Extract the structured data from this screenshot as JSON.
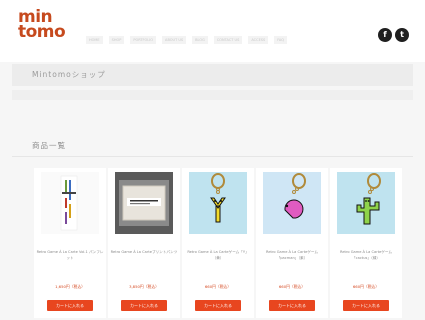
{
  "header": {
    "logo_line1": "min",
    "logo_line2": "tomo",
    "nav": [
      "HOME",
      "SHOP",
      "PORTFOLIO",
      "ABOUT US",
      "BLOG",
      "CONTACT US",
      "ACCESS",
      "FAQ"
    ],
    "social": {
      "facebook": "f",
      "twitter": "t"
    }
  },
  "shop_title": "Mintomoショップ",
  "section_title": "商品一覧",
  "products": [
    {
      "name": "Retro Game À La Carte Vol.1 パンフレット",
      "price": "1,650円（税込）",
      "cart": "カートに入れる",
      "thumb": "book"
    },
    {
      "name": "Retro Game À La Carteプリントパンツ",
      "price": "3,850円（税込）",
      "cart": "カートに入れる",
      "thumb": "package"
    },
    {
      "name": "Retro Game À La Carteゲーム「Y」（黄）",
      "price": "660円（税込）",
      "cart": "カートに入れる",
      "thumb": "keychain-yellow"
    },
    {
      "name": "Retro Game À La Carteゲーム「pacman」（紫）",
      "price": "660円（税込）",
      "cart": "カートに入れる",
      "thumb": "keychain-pink"
    },
    {
      "name": "Retro Game À La Carteゲーム「cactus」（緑）",
      "price": "660円（税込）",
      "cart": "カートに入れる",
      "thumb": "keychain-green"
    }
  ],
  "colors": {
    "accent": "#e8461f",
    "brand": "#c64a1e",
    "price": "#d4471f"
  }
}
